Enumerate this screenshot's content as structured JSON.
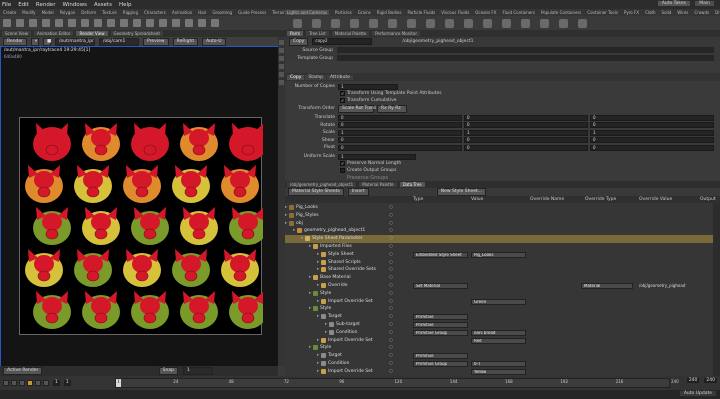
{
  "menu": [
    "File",
    "Edit",
    "Render",
    "Windows",
    "Assets",
    "Help"
  ],
  "top_right": {
    "build_label": "Auto Takes",
    "main_label": "Main"
  },
  "shelf_left": [
    "Create",
    "Modify",
    "Model",
    "Polygon",
    "Deform",
    "Texture",
    "Rigging",
    "Characters",
    "Animation",
    "Hair",
    "Grooming",
    "Guide Process",
    "Terrain FX"
  ],
  "shelf_right": [
    "Lights and Cameras",
    "Particles",
    "Grains",
    "Rigid Bodies",
    "Particle Fluids",
    "Viscous Fluids",
    "Oceans FX",
    "Fluid Containers",
    "Populate Containers",
    "Container Tools",
    "Pyro FX",
    "Cloth",
    "Solid",
    "Wires",
    "Crowds",
    "Drive Simulation"
  ],
  "left_pane_tabs": [
    "Scene View",
    "Animation Editor",
    "Render View",
    "Geometry Spreadsheet"
  ],
  "left_pane_active": 2,
  "viewport": {
    "render_label": "Render",
    "path_field": "/out/mantra_ipr",
    "camera": "/obj/cam1",
    "preview_label": "Preview",
    "rerender_label": "ReRight",
    "auto_label": "Auto-U",
    "overlay_title": "/out/mantra_ipr/raytrace4 19:29:45[1]",
    "overlay_sub": "640x480"
  },
  "vp_bottom": [
    "Active Render",
    "Snap"
  ],
  "right_pane_tabs": [
    "Parm",
    "Tree List",
    "Material Palette",
    "Performance Monitor"
  ],
  "node": {
    "type_label": "Copy",
    "name": "copy2",
    "path": "/obj/geometry_pighead_object1"
  },
  "header_fields": [
    {
      "label": "Source Group",
      "value": ""
    },
    {
      "label": "Template Group",
      "value": ""
    }
  ],
  "param_tabs": [
    "Copy",
    "Stamp",
    "Attribute"
  ],
  "params": {
    "number_of_copies": {
      "label": "Number of Copies",
      "value": "1"
    },
    "transform_using_points": "Transform Using Template Point Attributes",
    "transform_cumulative": "Transform Cumulative",
    "transform_order": {
      "label": "Transform Order",
      "value": "Scale Rot Trans",
      "rot_value": "Rx Ry Rz"
    },
    "translate": {
      "label": "Translate",
      "values": [
        "0",
        "0",
        "0"
      ]
    },
    "rotate": {
      "label": "Rotate",
      "values": [
        "0",
        "0",
        "0"
      ]
    },
    "scale": {
      "label": "Scale",
      "values": [
        "1",
        "1",
        "1"
      ]
    },
    "shear": {
      "label": "Shear",
      "values": [
        "0",
        "0",
        "0"
      ]
    },
    "pivot": {
      "label": "Pivot",
      "values": [
        "0",
        "0",
        "0"
      ]
    },
    "uniform_scale": {
      "label": "Uniform Scale",
      "value": "1"
    },
    "preserve_normal": "Preserve Normal Length",
    "create_output_groups": "Create Output Groups",
    "preserve_groups": "Preserve Groups"
  },
  "lower_tabs": [
    "/obj/geometry_pighead_object1",
    "Material Palette",
    "Data Tree"
  ],
  "lower_active": 2,
  "ss_toolbar": {
    "dropdown": "Material Style Sheets",
    "insert": "Insert",
    "new_button": "New Style Sheet..."
  },
  "ss_columns": [
    "Type",
    "Value",
    "Override Name",
    "Override Type",
    "Override Value",
    "Output"
  ],
  "tree": [
    {
      "name": "Pig_Looks",
      "level": 0,
      "color": "#8a6d3b",
      "combo": "",
      "val": "",
      "extra": ""
    },
    {
      "name": "Pig_Styles",
      "level": 0,
      "color": "#8a6d3b",
      "combo": "",
      "val": "",
      "extra": ""
    },
    {
      "name": "obj",
      "level": 0,
      "color": "#8a6d3b",
      "combo": "",
      "val": "",
      "extra": ""
    },
    {
      "name": "geometry_pighead_object1",
      "level": 1,
      "color": "#c68a3a",
      "combo": "",
      "val": "",
      "extra": ""
    },
    {
      "name": "Style Sheet Parameter",
      "level": 2,
      "color": "#d4b15a",
      "combo": "",
      "val": "",
      "extra": "",
      "sel": true
    },
    {
      "name": "Imported Files",
      "level": 3,
      "color": "#c9a04a",
      "combo": "",
      "val": "",
      "extra": ""
    },
    {
      "name": "Style Sheet",
      "level": 4,
      "color": "#c9a04a",
      "combo": "Embedded Style Sheet",
      "val": "Pig_Looks",
      "extra": ""
    },
    {
      "name": "Shared Scripts",
      "level": 4,
      "color": "#c9a04a",
      "combo": "",
      "val": "",
      "extra": ""
    },
    {
      "name": "Shared Override Sets",
      "level": 4,
      "color": "#c9a04a",
      "combo": "",
      "val": "",
      "extra": ""
    },
    {
      "name": "Base Material",
      "level": 3,
      "color": "#c9a04a",
      "combo": "",
      "val": "",
      "extra": ""
    },
    {
      "name": "Override",
      "level": 4,
      "color": "#c9a04a",
      "combo": "Set Material",
      "val": "",
      "extra": "/obj/geometry_pighead"
    },
    {
      "name": "Style",
      "level": 3,
      "color": "#6b8a3b",
      "combo": "",
      "val": "",
      "extra": ""
    },
    {
      "name": "Import Override Set",
      "level": 4,
      "color": "#c9a04a",
      "combo": "",
      "val": "Green",
      "extra": ""
    },
    {
      "name": "Style",
      "level": 3,
      "color": "#6b8a3b",
      "combo": "",
      "val": "",
      "extra": ""
    },
    {
      "name": "Target",
      "level": 4,
      "color": "#8a8a8a",
      "combo": "Primitive",
      "val": "",
      "extra": ""
    },
    {
      "name": "Sub-target",
      "level": 5,
      "color": "#8a8a8a",
      "combo": "Primitive",
      "val": "",
      "extra": ""
    },
    {
      "name": "Condition",
      "level": 5,
      "color": "#8a8a8a",
      "combo": "Primitive Group",
      "val": "ears bread",
      "extra": ""
    },
    {
      "name": "Import Override Set",
      "level": 4,
      "color": "#c9a04a",
      "combo": "",
      "val": "Red",
      "extra": ""
    },
    {
      "name": "Style",
      "level": 3,
      "color": "#6b8a3b",
      "combo": "",
      "val": "",
      "extra": ""
    },
    {
      "name": "Target",
      "level": 4,
      "color": "#8a8a8a",
      "combo": "Primitive",
      "val": "",
      "extra": ""
    },
    {
      "name": "Condition",
      "level": 4,
      "color": "#8a8a8a",
      "combo": "Primitive Group",
      "val": "0-7",
      "extra": ""
    },
    {
      "name": "Import Override Set",
      "level": 4,
      "color": "#c9a04a",
      "combo": "",
      "val": "Yellow",
      "extra": ""
    }
  ],
  "timeline": {
    "start": "1",
    "current": "1",
    "end": "240",
    "end2": "240",
    "ticks": [
      "1",
      "24",
      "48",
      "72",
      "96",
      "120",
      "144",
      "168",
      "192",
      "216",
      "240"
    ],
    "status": "Auto Update"
  },
  "pig_colors": {
    "red": "#d4182a",
    "orange": "#e08a2e",
    "green": "#7a9a2a",
    "yellow": "#d6c23a"
  }
}
